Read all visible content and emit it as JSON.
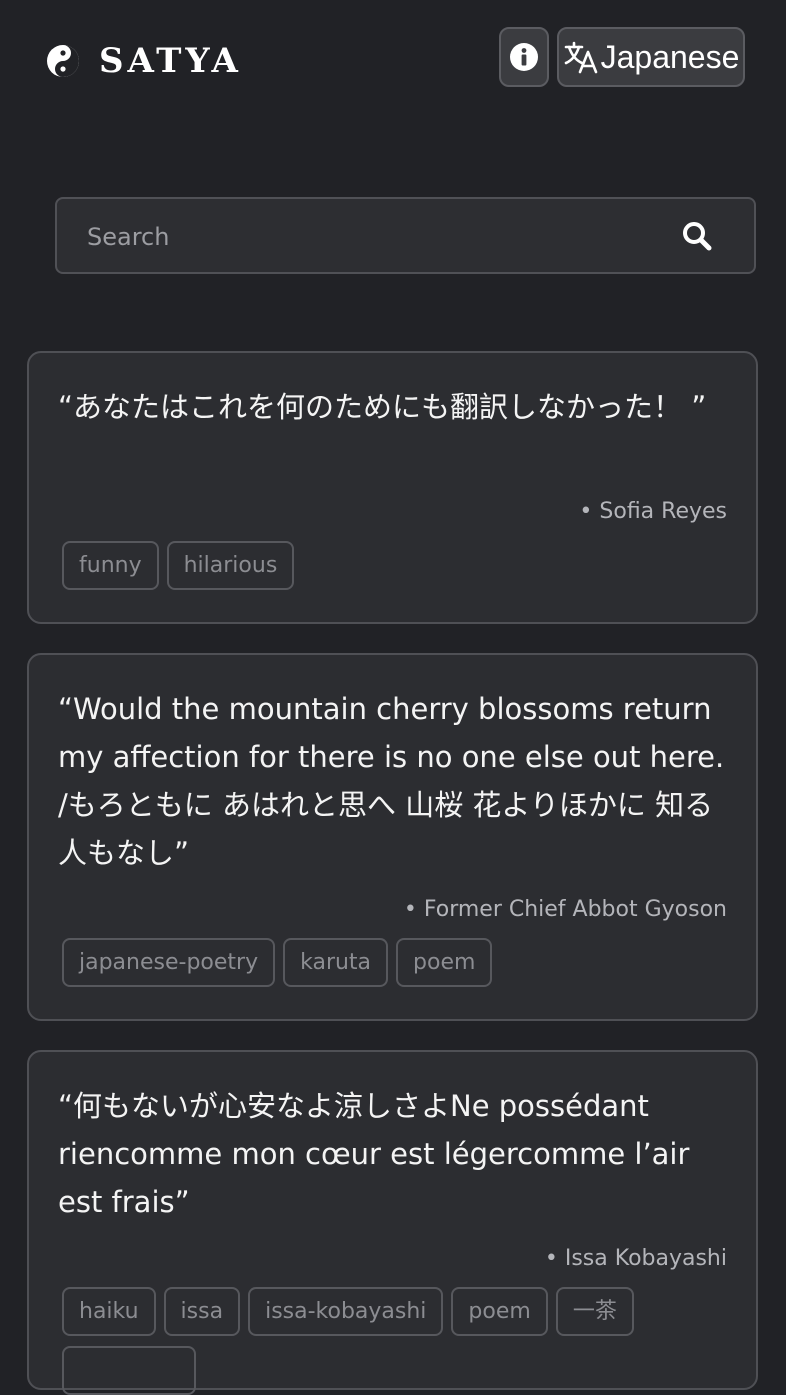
{
  "header": {
    "brand": "SATYA",
    "language_label": "Japanese"
  },
  "search": {
    "placeholder": "Search"
  },
  "quotes": [
    {
      "text": "“あなたはこれを何のためにも翻訳しなかった！ ”",
      "author": "• Sofia Reyes",
      "tags": [
        "funny",
        "hilarious"
      ]
    },
    {
      "text": "“Would the mountain cherry blossoms return my affection for there is no one else out here. /もろともに あはれと思へ 山桜 花よりほかに 知る人もなし”",
      "author": "• Former Chief Abbot Gyoson",
      "tags": [
        "japanese-poetry",
        "karuta",
        "poem"
      ]
    },
    {
      "text": "“何もないが心安なよ涼しさよNe possédant riencomme mon cœur est légercomme l’air est frais”",
      "author": "• Issa Kobayashi",
      "tags": [
        "haiku",
        "issa",
        "issa-kobayashi",
        "poem",
        "一茶",
        ""
      ]
    }
  ]
}
